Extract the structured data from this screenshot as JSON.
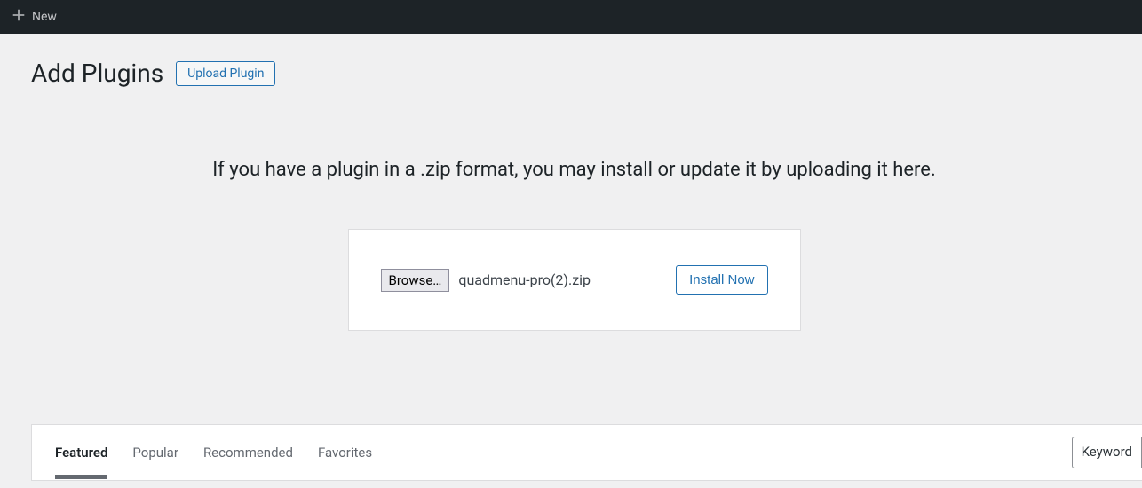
{
  "admin_bar": {
    "new_label": "New"
  },
  "page": {
    "title": "Add Plugins",
    "upload_button": "Upload Plugin"
  },
  "upload": {
    "description": "If you have a plugin in a .zip format, you may install or update it by uploading it here.",
    "browse_label": "Browse…",
    "selected_file": "quadmenu-pro(2).zip",
    "install_label": "Install Now"
  },
  "tabs": {
    "featured": "Featured",
    "popular": "Popular",
    "recommended": "Recommended",
    "favorites": "Favorites"
  },
  "search": {
    "type_label": "Keyword"
  }
}
